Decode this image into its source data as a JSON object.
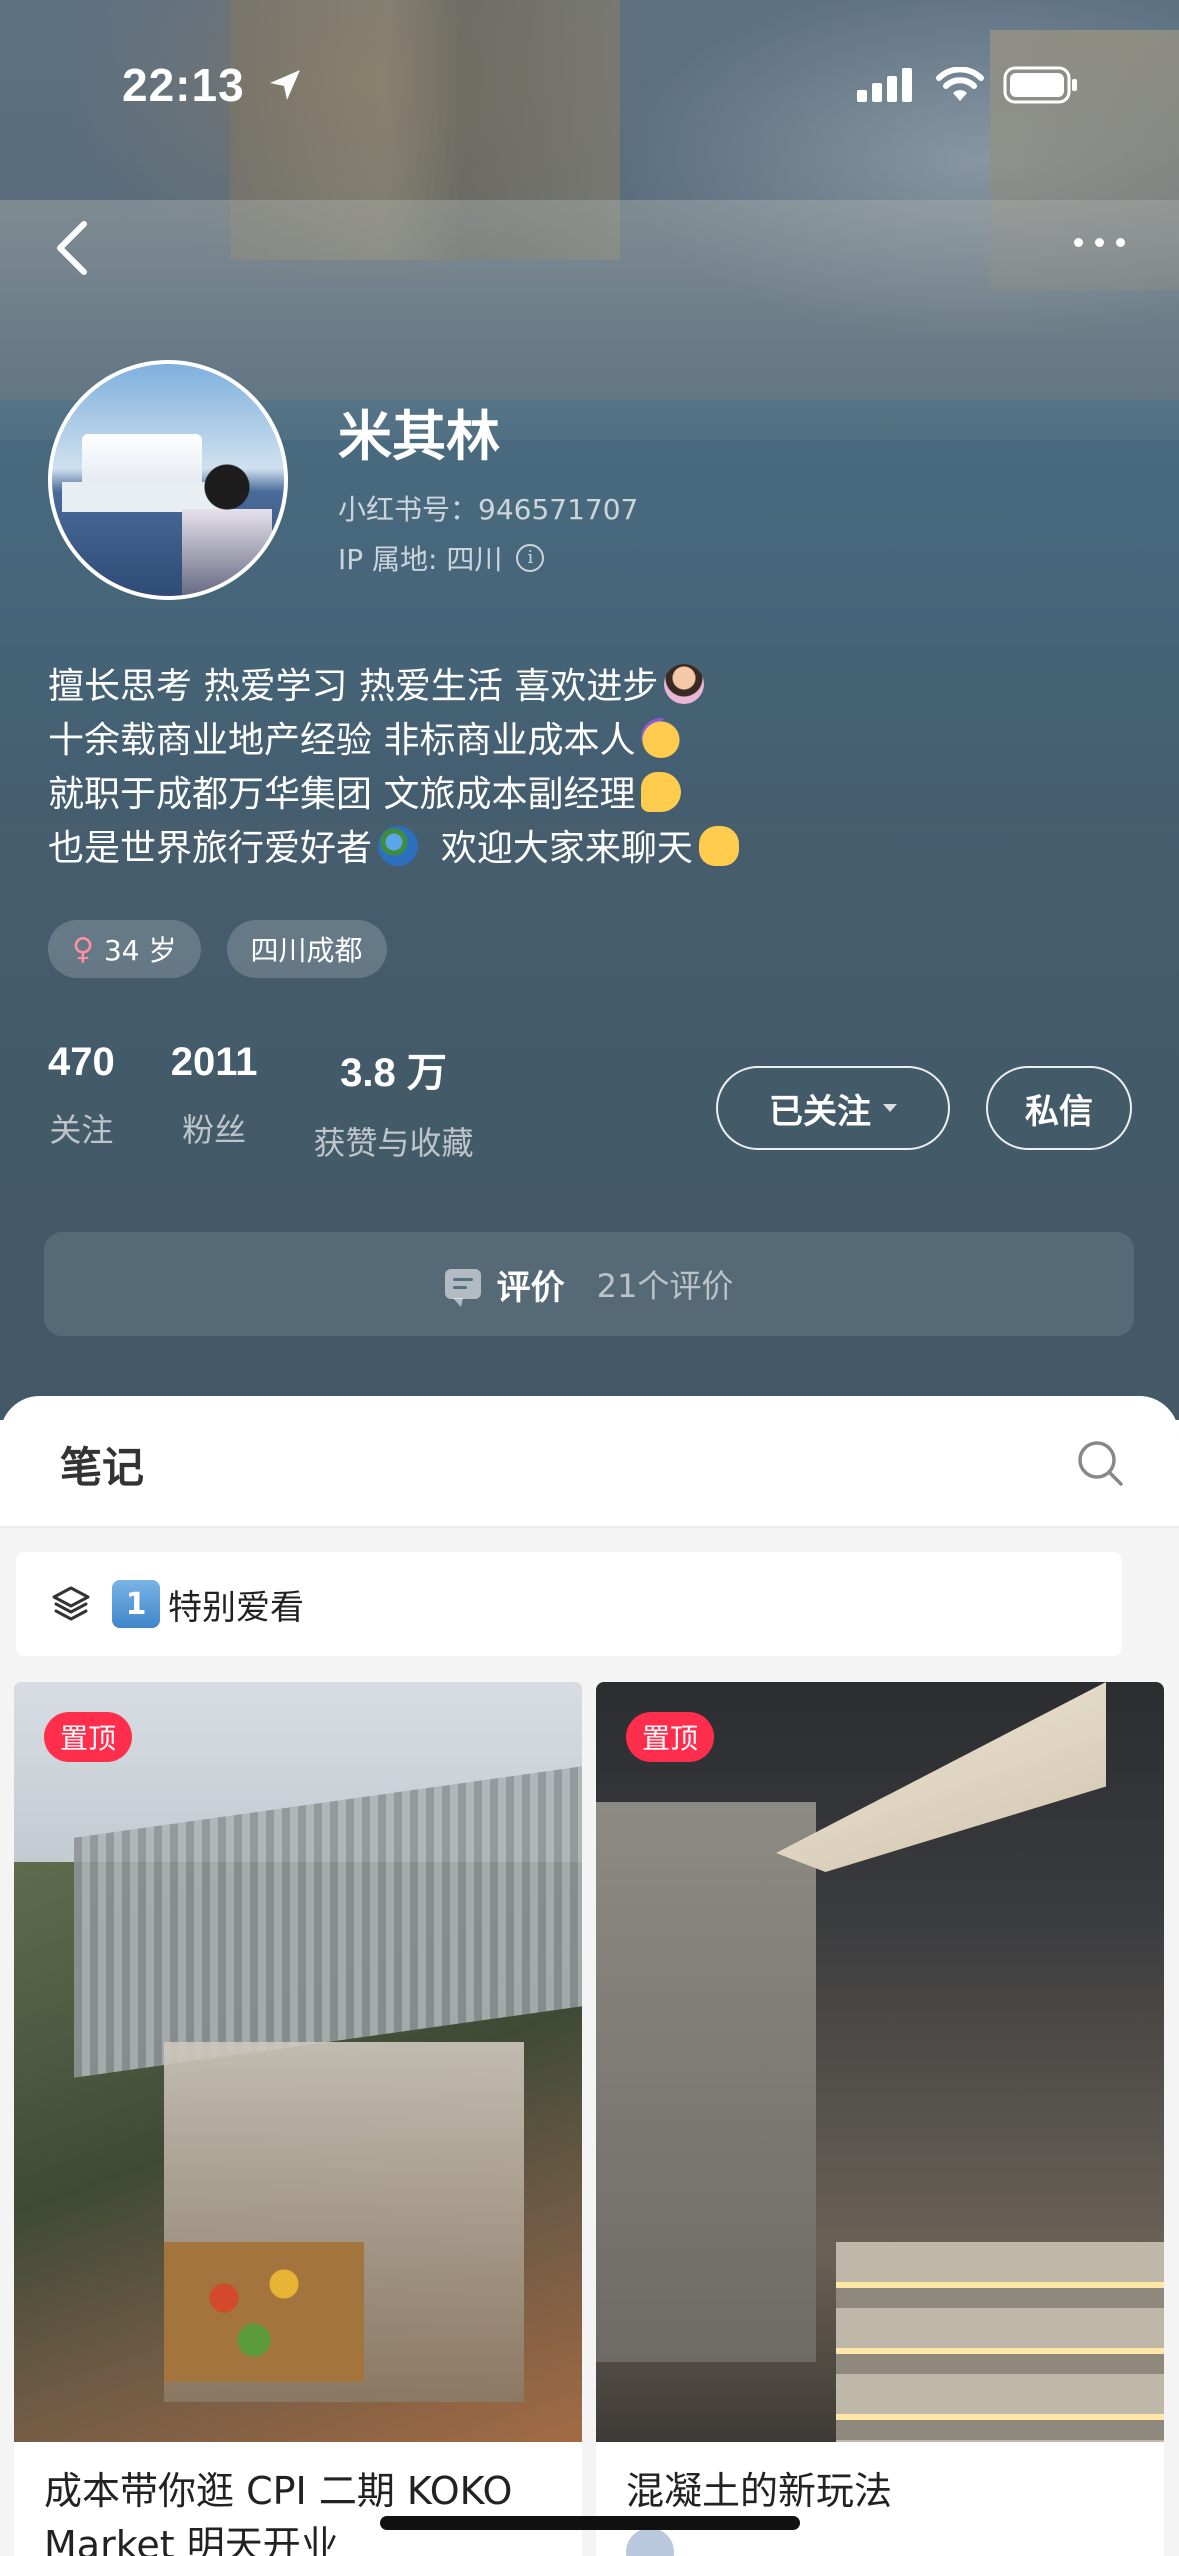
{
  "status_bar": {
    "time": "22:13",
    "icons": [
      "location-arrow-icon",
      "cellular-signal-icon",
      "wifi-icon",
      "battery-icon"
    ]
  },
  "nav": {
    "back_icon": "chevron-left-icon",
    "more_icon": "more-dots-icon"
  },
  "profile": {
    "name": "米其林",
    "red_id": "小红书号：946571707",
    "ip_location": "IP 属地: 四川",
    "info_icon": "info-icon",
    "bio": [
      "擅长思考 热爱学习 热爱生活 喜欢进步",
      "十余载商业地产经验  非标商业成本人",
      "就职于成都万华集团 文旅成本副经理",
      "也是世界旅行爱好者",
      "欢迎大家来聊天"
    ],
    "tags": {
      "gender_symbol": "♀",
      "age": "34 岁",
      "location": "四川成都"
    }
  },
  "stats": [
    {
      "value": "470",
      "label": "关注"
    },
    {
      "value": "2011",
      "label": "粉丝"
    },
    {
      "value": "3.8 万",
      "label": "获赞与收藏"
    }
  ],
  "actions": {
    "follow_label": "已关注",
    "message_label": "私信"
  },
  "reviews": {
    "label": "评价",
    "count": "21个评价"
  },
  "notes": {
    "tab_label": "笔记",
    "collection": {
      "badge": "1",
      "label": "特别爱看"
    },
    "cards": [
      {
        "pin_label": "置顶",
        "title": "成本带你逛 CPI 二期 KOKO Market 明天开业"
      },
      {
        "pin_label": "置顶",
        "title": "混凝土的新玩法"
      }
    ]
  },
  "colors": {
    "pin": "#ff2e4d",
    "header_bg": "#4b6576"
  }
}
